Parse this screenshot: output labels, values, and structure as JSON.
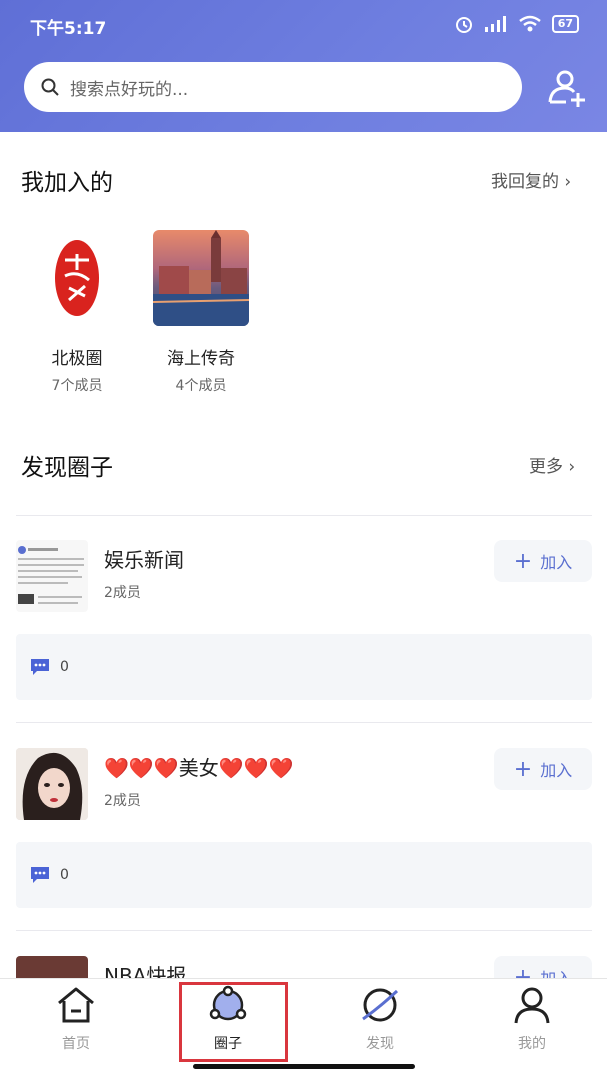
{
  "status_bar": {
    "time": "下午5:17",
    "battery": "67"
  },
  "search": {
    "placeholder": "搜索点好玩的..."
  },
  "joined": {
    "title": "我加入的",
    "link": "我回复的 ›",
    "items": [
      {
        "name": "北极圈",
        "members": "7个成员"
      },
      {
        "name": "海上传奇",
        "members": "4个成员"
      }
    ]
  },
  "discover": {
    "title": "发现圈子",
    "link": "更多 ›",
    "groups": [
      {
        "name": "娱乐新闻",
        "members": "2成员",
        "join_label": "加入",
        "comments": "0"
      },
      {
        "name": "❤️❤️❤️美女❤️❤️❤️",
        "members": "2成员",
        "join_label": "加入",
        "comments": "0"
      },
      {
        "name": "NBA快报",
        "members": "",
        "join_label": "加入",
        "comments": ""
      }
    ]
  },
  "tabbar": {
    "tabs": [
      {
        "label": "首页",
        "icon": "home-icon"
      },
      {
        "label": "圈子",
        "icon": "circle-network-icon"
      },
      {
        "label": "发现",
        "icon": "planet-icon"
      },
      {
        "label": "我的",
        "icon": "user-icon"
      }
    ],
    "active": 1
  },
  "colors": {
    "header": "#6574d9",
    "accent": "#5a6fd0",
    "highlight": "#d9363e"
  }
}
